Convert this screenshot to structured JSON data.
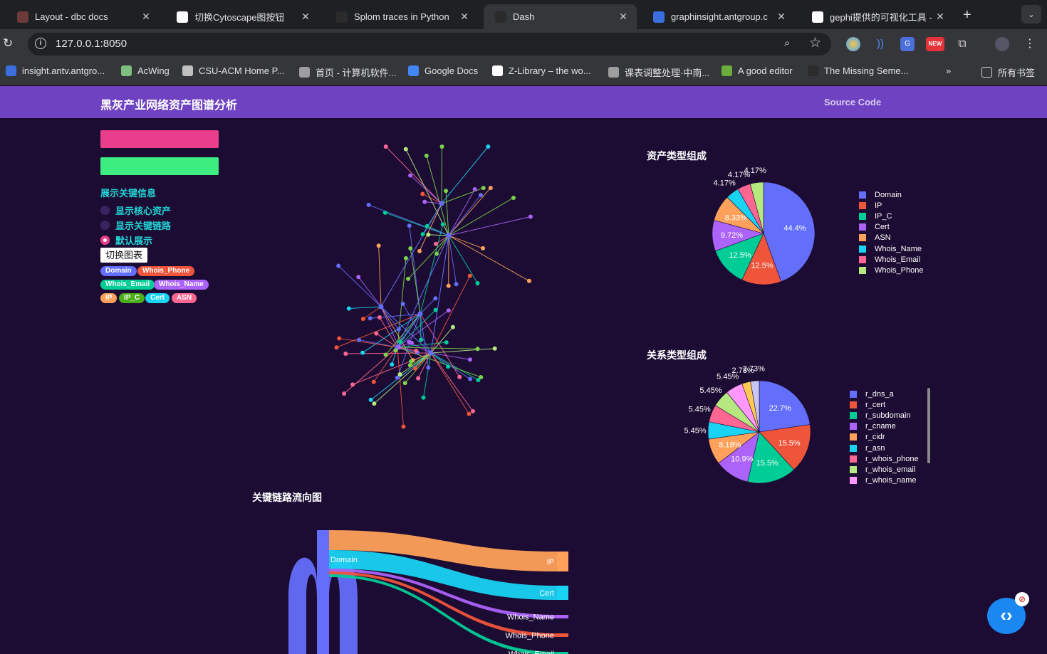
{
  "browser": {
    "tabs": [
      {
        "label": "Layout - dbc docs",
        "icon": "dbc-logo-icon",
        "color": "#6b3a3a"
      },
      {
        "label": "切换Cytoscape图按钮",
        "icon": "openai-logo-icon",
        "color": "#ffffff"
      },
      {
        "label": "Splom traces in Python",
        "icon": "plotly-logo-icon",
        "color": "#2b2b2b"
      },
      {
        "label": "Dash",
        "icon": "plotly-logo-icon",
        "color": "#2b2b2b"
      },
      {
        "label": "graphinsight.antgroup.c",
        "icon": "graphinsight-logo-icon",
        "color": "#3b6fe0"
      },
      {
        "label": "gephi提供的可视化工具 -",
        "icon": "google-logo-icon",
        "color": "#ffffff"
      }
    ],
    "url": "127.0.0.1:8050",
    "bookmarks": [
      {
        "label": "insight.antv.antgro...",
        "color": "#3b6fe0"
      },
      {
        "label": "AcWing",
        "color": "#7fbf7f"
      },
      {
        "label": "CSU-ACM Home P...",
        "color": "#c0c0c0"
      },
      {
        "label": "首页 - 计算机软件...",
        "color": "#9e9e9e"
      },
      {
        "label": "Google Docs",
        "color": "#4285f4"
      },
      {
        "label": "Z-Library – the wo...",
        "color": "#ffffff"
      },
      {
        "label": "课表调整处理·中南...",
        "color": "#9e9e9e"
      },
      {
        "label": "A good editor",
        "color": "#6cae3e"
      },
      {
        "label": "The Missing Seme...",
        "color": "#2b2b2b"
      }
    ],
    "all_bookmarks": "所有书签",
    "ext_new_badge": "NEW"
  },
  "app": {
    "title": "黑灰产业网络资产图谱分析",
    "source_link": "Source Code",
    "section_title": "展示关键信息",
    "radios": [
      {
        "label": "显示核心资产",
        "selected": false
      },
      {
        "label": "显示关键链路",
        "selected": false
      },
      {
        "label": "默认展示",
        "selected": true
      }
    ],
    "switch_button": "切换图表",
    "badges": [
      {
        "label": "Domain",
        "color": "#636efa"
      },
      {
        "label": "Whois_Phone",
        "color": "#ef553b"
      },
      {
        "label": "Whois_Email",
        "color": "#00cc96"
      },
      {
        "label": "Whois_Name",
        "color": "#ab63fa"
      },
      {
        "label": "IP",
        "color": "#ffa15a"
      },
      {
        "label": "IP_C",
        "color": "#4caf1a"
      },
      {
        "label": "Cert",
        "color": "#19d3f3"
      },
      {
        "label": "ASN",
        "color": "#ff6692"
      }
    ]
  },
  "chart_data": [
    {
      "type": "pie",
      "title": "资产类型组成",
      "categories": [
        "Domain",
        "IP",
        "IP_C",
        "Cert",
        "ASN",
        "Whois_Name",
        "Whois_Email",
        "Whois_Phone"
      ],
      "values": [
        44.4,
        12.5,
        12.5,
        9.72,
        8.33,
        4.17,
        4.17,
        4.17
      ],
      "labels": [
        "44.4%",
        "12.5%",
        "12.5%",
        "9.72%",
        "8.33%",
        "4.17%",
        "4.17%",
        "4.17%"
      ],
      "colors": [
        "#636efa",
        "#ef553b",
        "#00cc96",
        "#ab63fa",
        "#ffa15a",
        "#19d3f3",
        "#ff6692",
        "#b6e880"
      ],
      "legend": "right"
    },
    {
      "type": "pie",
      "title": "关系类型组成",
      "categories": [
        "r_dns_a",
        "r_cert",
        "r_subdomain",
        "r_cname",
        "r_cidr",
        "r_asn",
        "r_whois_phone",
        "r_whois_email",
        "r_whois_name",
        "",
        ""
      ],
      "values": [
        22.7,
        15.5,
        15.5,
        10.9,
        8.18,
        5.45,
        5.45,
        5.45,
        5.45,
        2.73,
        2.73
      ],
      "labels": [
        "22.7%",
        "15.5%",
        "15.5%",
        "10.9%",
        "8.18%",
        "5.45%",
        "5.45%",
        "5.45%",
        "5.45%",
        "2.73%",
        "2.73%"
      ],
      "colors": [
        "#636efa",
        "#ef553b",
        "#00cc96",
        "#ab63fa",
        "#ffa15a",
        "#19d3f3",
        "#ff6692",
        "#b6e880",
        "#ff97ff",
        "#fecb52",
        "#c6c6f0"
      ],
      "legend": "right"
    },
    {
      "type": "sankey",
      "title": "关键链路流向图",
      "source": "Domain",
      "targets": [
        "IP",
        "Cert",
        "Whois_Name",
        "Whois_Phone",
        "Whois_Email"
      ],
      "colors": [
        "#ffa15a",
        "#19d3f3",
        "#ab63fa",
        "#ef553b",
        "#00cc96"
      ]
    }
  ]
}
